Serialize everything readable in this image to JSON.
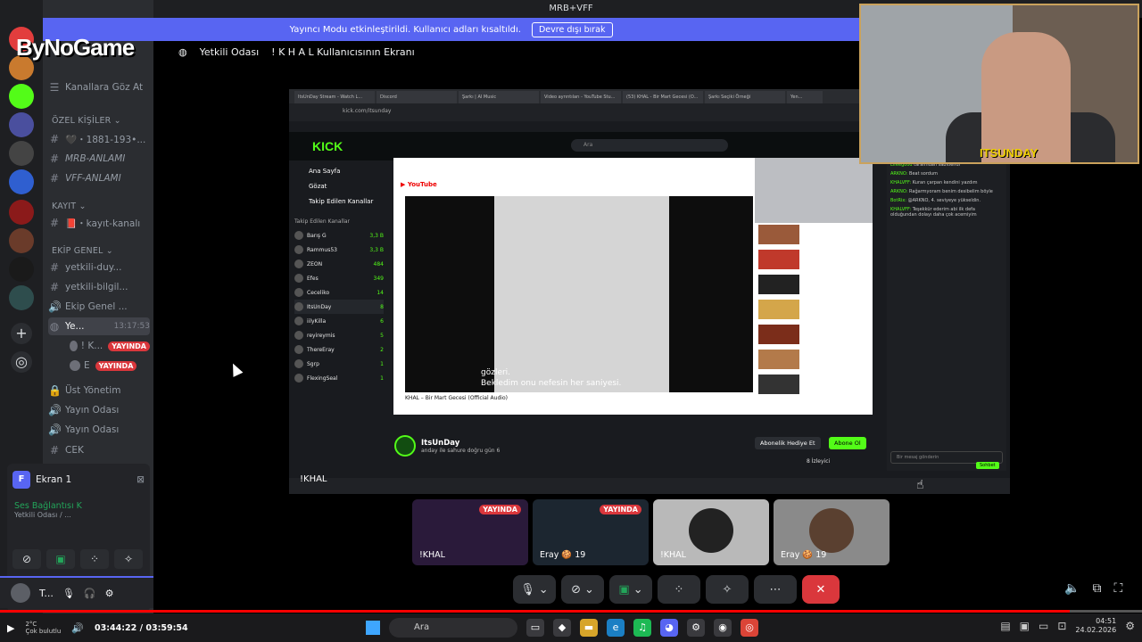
{
  "window": {
    "title": "MRB+VFF",
    "nav_arrows": "← →"
  },
  "notice": {
    "text": "Yayıncı Modu etkinleştirildi. Kullanıcı adları kısaltıldı.",
    "button": "Devre dışı bırak"
  },
  "watermark": "ByNoGame",
  "call_header": {
    "channel": "Yetkili Odası",
    "screen": "! K H A L Kullanıcısının Ekranı"
  },
  "sidebar": {
    "browse": "Kanallara Göz At",
    "cat_ozel": "ÖZEL KİŞİLER ⌄",
    "ozel": [
      "🖤・1881-193•...",
      "MRB-ANLAMI",
      "VFF-ANLAMI"
    ],
    "cat_kayit": "KAYIT ⌄",
    "kayit": [
      "📕・kayıt-kanalı"
    ],
    "cat_ekip": "EKİP GENEL ⌄",
    "ekip": [
      "yetkili-duy...",
      "yetkili-bilgil...",
      "Ekip Genel ...",
      "Ye...",
      "Üst Yönetim",
      "Yayın Odası",
      "Yayın Odası",
      "CEK"
    ],
    "active_time": "13:17:53",
    "members": [
      {
        "name": "! K...",
        "badge": "YAYINDA"
      },
      {
        "name": "E",
        "badge": "YAYINDA"
      }
    ]
  },
  "screen_panel": {
    "title": "Ekran 1",
    "voice_status": "Ses Bağlantısı K",
    "voice_sub": "Yetkili Odası / ..."
  },
  "user": {
    "name": "T..."
  },
  "browser": {
    "tabs": [
      "ItsUnDay Stream - Watch L...",
      "Discord",
      "Şarkı | AI Music",
      "Video ayrıntıları - YouTube Stu...",
      "(53) KHAL - Bir Mart Gecesi (O...",
      "Şarkı Seçiki Örneği",
      "Yen..."
    ],
    "url": "kick.com/itsunday",
    "kick_logo": "KICK",
    "search": "Ara",
    "nav": [
      "Ana Sayfa",
      "Gözat",
      "Takip Edilen Kanallar"
    ],
    "follow_title": "Takip Edilen Kanallar",
    "channels": [
      {
        "name": "Barış G",
        "count": "3,3 B"
      },
      {
        "name": "Rammus53",
        "count": "3,3 B"
      },
      {
        "name": "ZEON",
        "count": "484"
      },
      {
        "name": "Efes",
        "count": "349"
      },
      {
        "name": "Ceceliko",
        "count": "14"
      },
      {
        "name": "ItsUnDay",
        "count": "8"
      },
      {
        "name": "iilyKilla",
        "count": "6"
      },
      {
        "name": "reyireymis",
        "count": "5"
      },
      {
        "name": "ThereEray",
        "count": "2"
      },
      {
        "name": "Sgrp",
        "count": "1"
      },
      {
        "name": "FlexingSeal",
        "count": "1"
      }
    ],
    "video_title": "KHAL – Bir Mart Gecesi (Official Audio)",
    "subtitle": [
      "gözleri.",
      "Bekledim onu nefesin her saniyesi."
    ],
    "streamer": {
      "name": "ItsUnDay",
      "desc": "anday ile sahure doğru gün 6",
      "viewers": "8 İzleyici"
    },
    "btn_gift": "Abonelik Hediye Et",
    "btn_sub": "Abone Ol",
    "chat": [
      {
        "user": "Lifeegood",
        "text": "tarafından sabitlendi"
      },
      {
        "user": "ARKNO:",
        "text": "Beat sordum"
      },
      {
        "user": "KHALVFF:",
        "text": "Kuran çarpan kendini yazdım"
      },
      {
        "user": "ARKNO:",
        "text": "Rağarmyoram benim desibelim böyle"
      },
      {
        "user": "BotRix:",
        "text": "@ARKNO, 4. seviyeye yükseldin."
      },
      {
        "user": "KHALVFF:",
        "text": "Teşekkür ederim abi ilk defa olduğundan dolayı daha çok acemiyim"
      }
    ],
    "chat_input": "Bir mesaj gönderin",
    "chat_send": "Sohbet"
  },
  "screen_owner_tag": "!KHAL",
  "webcam": {
    "caption": "ITSUNDAY"
  },
  "tiles": [
    {
      "label": "!KHAL",
      "badge": "YAYINDA"
    },
    {
      "label": "Eray 🍪 19",
      "badge": "YAYINDA"
    },
    {
      "label": "!KHAL",
      "badge": ""
    },
    {
      "label": "Eray 🍪 19",
      "badge": ""
    }
  ],
  "player": {
    "current": "03:44:22",
    "total": "03:59:54",
    "progress_fraction": 0.937,
    "weather": "2°C",
    "weather_sub": "Çok bulutlu"
  },
  "taskbar": {
    "search": "Ara",
    "time": "04:51",
    "date": "24.02.2026"
  }
}
